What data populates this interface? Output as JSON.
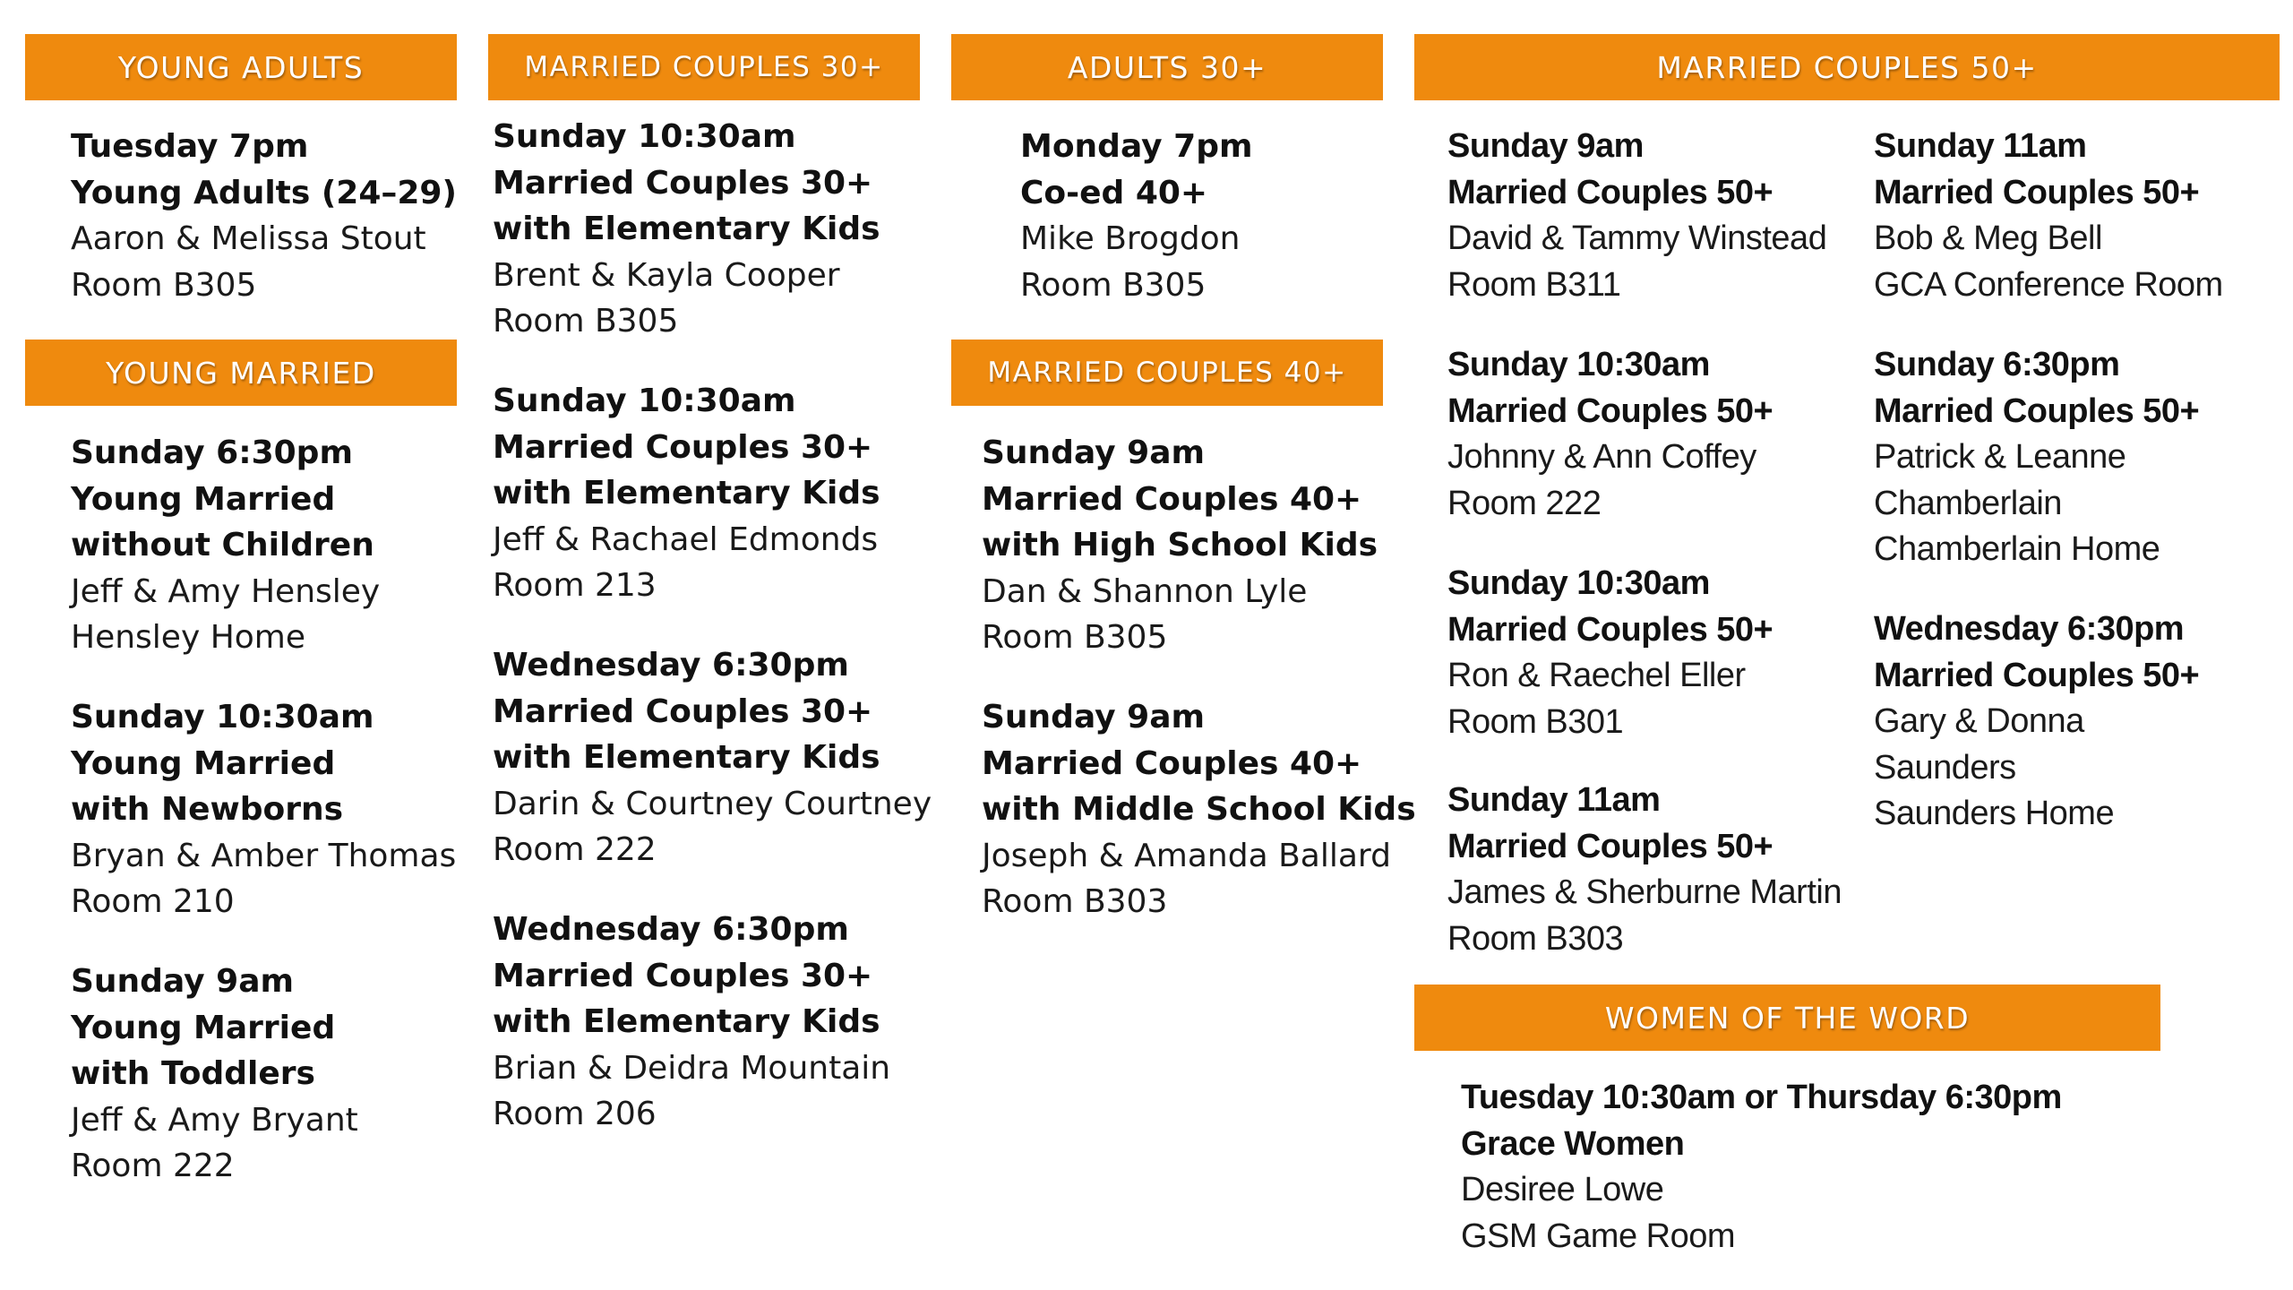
{
  "accent_color": "#EF8A0E",
  "sections": {
    "young_adults": {
      "title": "YOUNG ADULTS",
      "groups": [
        {
          "time": "Tuesday 7pm",
          "name": "Young Adults (24–29)",
          "leaders": "Aaron & Melissa Stout",
          "location": "Room B305"
        }
      ]
    },
    "young_married": {
      "title": "YOUNG MARRIED",
      "groups": [
        {
          "time": "Sunday 6:30pm",
          "name": "Young Married",
          "name2": "without Children",
          "leaders": "Jeff & Amy Hensley",
          "location": "Hensley Home"
        },
        {
          "time": "Sunday 10:30am",
          "name": "Young Married",
          "name2": "with Newborns",
          "leaders": "Bryan & Amber Thomas",
          "location": "Room 210"
        },
        {
          "time": "Sunday 9am",
          "name": "Young Married",
          "name2": "with Toddlers",
          "leaders": "Jeff & Amy Bryant",
          "location": "Room 222"
        }
      ]
    },
    "married_30": {
      "title": "MARRIED COUPLES  30+",
      "groups": [
        {
          "time": "Sunday 10:30am",
          "name": "Married Couples 30+",
          "name2": "with Elementary Kids",
          "leaders": "Brent & Kayla Cooper",
          "location": "Room B305"
        },
        {
          "time": "Sunday 10:30am",
          "name": "Married Couples 30+",
          "name2": "with Elementary Kids",
          "leaders": "Jeff & Rachael Edmonds",
          "location": "Room 213"
        },
        {
          "time": "Wednesday 6:30pm",
          "name": "Married Couples 30+",
          "name2": "with Elementary Kids",
          "leaders": "Darin & Courtney Courtney",
          "location": "Room 222"
        },
        {
          "time": "Wednesday 6:30pm",
          "name": "Married Couples 30+",
          "name2": "with Elementary Kids",
          "leaders": "Brian & Deidra Mountain",
          "location": "Room 206"
        }
      ]
    },
    "adults_30": {
      "title": "ADULTS 30+",
      "groups": [
        {
          "time": "Monday 7pm",
          "name": "Co-ed 40+",
          "leaders": "Mike Brogdon",
          "location": "Room B305"
        }
      ]
    },
    "married_40": {
      "title": "MARRIED COUPLES  40+",
      "groups": [
        {
          "time": "Sunday 9am",
          "name": "Married Couples 40+",
          "name2": "with High School Kids",
          "leaders": "Dan & Shannon Lyle",
          "location": "Room B305"
        },
        {
          "time": "Sunday 9am",
          "name": "Married Couples 40+",
          "name2": "with Middle School Kids",
          "leaders": "Joseph & Amanda Ballard",
          "location": "Room B303"
        }
      ]
    },
    "married_50": {
      "title": "MARRIED COUPLES  50+",
      "groups": [
        {
          "time": "Sunday 9am",
          "name": "Married Couples 50+",
          "leaders": "David & Tammy Winstead",
          "location": "Room B311"
        },
        {
          "time": "Sunday 10:30am",
          "name": "Married Couples 50+",
          "leaders": "Johnny & Ann Coffey",
          "location": "Room 222"
        },
        {
          "time": "Sunday 10:30am",
          "name": "Married Couples 50+",
          "leaders": "Ron & Raechel Eller",
          "location": "Room B301"
        },
        {
          "time": "Sunday 11am",
          "name": "Married Couples 50+",
          "leaders": "James & Sherburne Martin",
          "location": "Room B303"
        },
        {
          "time": "Sunday 11am",
          "name": "Married Couples 50+",
          "leaders": "Bob & Meg Bell",
          "location": "GCA Conference Room"
        },
        {
          "time": "Sunday 6:30pm",
          "name": "Married Couples 50+",
          "leaders": "Patrick & Leanne",
          "leaders2": "Chamberlain",
          "location": "Chamberlain Home"
        },
        {
          "time": "Wednesday 6:30pm",
          "name": "Married Couples 50+",
          "leaders": "Gary & Donna",
          "leaders2": "Saunders",
          "location": "Saunders Home"
        }
      ]
    },
    "women": {
      "title": "WOMEN OF THE WORD",
      "groups": [
        {
          "time": "Tuesday 10:30am or Thursday 6:30pm",
          "name": "Grace Women",
          "leaders": "Desiree Lowe",
          "location": "GSM Game Room"
        }
      ]
    }
  }
}
